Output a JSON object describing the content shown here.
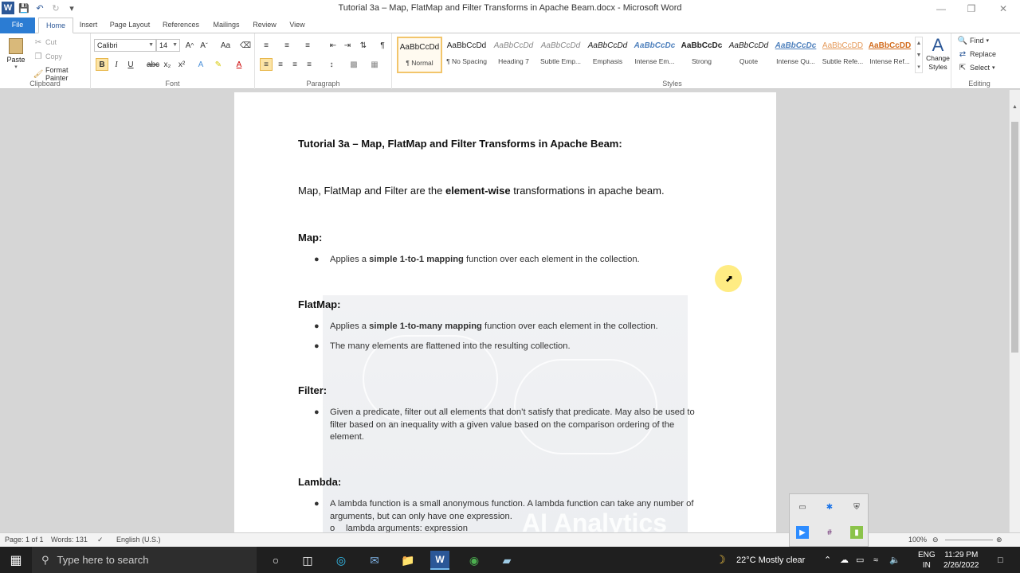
{
  "window": {
    "title": "Tutorial 3a – Map, FlatMap and Filter Transforms in Apache Beam.docx  -  Microsoft Word"
  },
  "tabs": [
    "File",
    "Home",
    "Insert",
    "Page Layout",
    "References",
    "Mailings",
    "Review",
    "View"
  ],
  "clipboard": {
    "paste": "Paste",
    "cut": "Cut",
    "copy": "Copy",
    "format_painter": "Format Painter",
    "label": "Clipboard"
  },
  "font": {
    "name": "Calibri",
    "size": "14",
    "label": "Font"
  },
  "paragraph": {
    "label": "Paragraph"
  },
  "styles": {
    "label": "Styles",
    "items": [
      {
        "preview": "AaBbCcDd",
        "name": "¶ Normal"
      },
      {
        "preview": "AaBbCcDd",
        "name": "¶ No Spacing"
      },
      {
        "preview": "AaBbCcDd",
        "name": "Heading 7"
      },
      {
        "preview": "AaBbCcDd",
        "name": "Subtle Emp..."
      },
      {
        "preview": "AaBbCcDd",
        "name": "Emphasis"
      },
      {
        "preview": "AaBbCcDc",
        "name": "Intense Em..."
      },
      {
        "preview": "AaBbCcDc",
        "name": "Strong"
      },
      {
        "preview": "AaBbCcDd",
        "name": "Quote"
      },
      {
        "preview": "AaBbCcDc",
        "name": "Intense Qu..."
      },
      {
        "preview": "AaBbCcDD",
        "name": "Subtle Refe..."
      },
      {
        "preview": "AaBbCcDD",
        "name": "Intense Ref..."
      }
    ],
    "change_styles": "Change Styles"
  },
  "editing": {
    "find": "Find",
    "replace": "Replace",
    "select": "Select",
    "label": "Editing"
  },
  "doc": {
    "title": "Tutorial 3a – Map, FlatMap and Filter Transforms  in Apache Beam:",
    "intro_a": "Map, FlatMap and Filter are the ",
    "intro_b": "element-wise",
    "intro_c": " transformations in apache beam.",
    "map_heading": "Map:",
    "map_b1_a": "Applies a ",
    "map_b1_b": "simple 1-to-1 mapping",
    "map_b1_c": " function over each element in the collection.",
    "flatmap_heading": "FlatMap:",
    "flatmap_b1_a": "Applies a ",
    "flatmap_b1_b": "simple 1-to-many mapping",
    "flatmap_b1_c": " function over each element in the collection.",
    "flatmap_b2": "The many elements are flattened into the resulting collection.",
    "filter_heading": "Filter:",
    "filter_b1": "Given a predicate, filter out all elements that don’t satisfy that predicate. May also be used to filter based on an inequality with a given value based on the comparison ordering of the element.",
    "lambda_heading": "Lambda:",
    "lambda_b1": "A lambda function is a small anonymous function. A lambda function can take any number of arguments, but can only have one expression.",
    "lambda_sub": "lambda arguments: expression",
    "watermark": "AI Analytics"
  },
  "status": {
    "page": "Page: 1 of 1",
    "words": "Words: 131",
    "language": "English (U.S.)",
    "zoom": "100%"
  },
  "taskbar": {
    "search_placeholder": "Type here to search",
    "weather": "22°C  Mostly clear",
    "lang1": "ENG",
    "lang2": "IN",
    "time": "11:29 PM",
    "date": "2/26/2022"
  }
}
